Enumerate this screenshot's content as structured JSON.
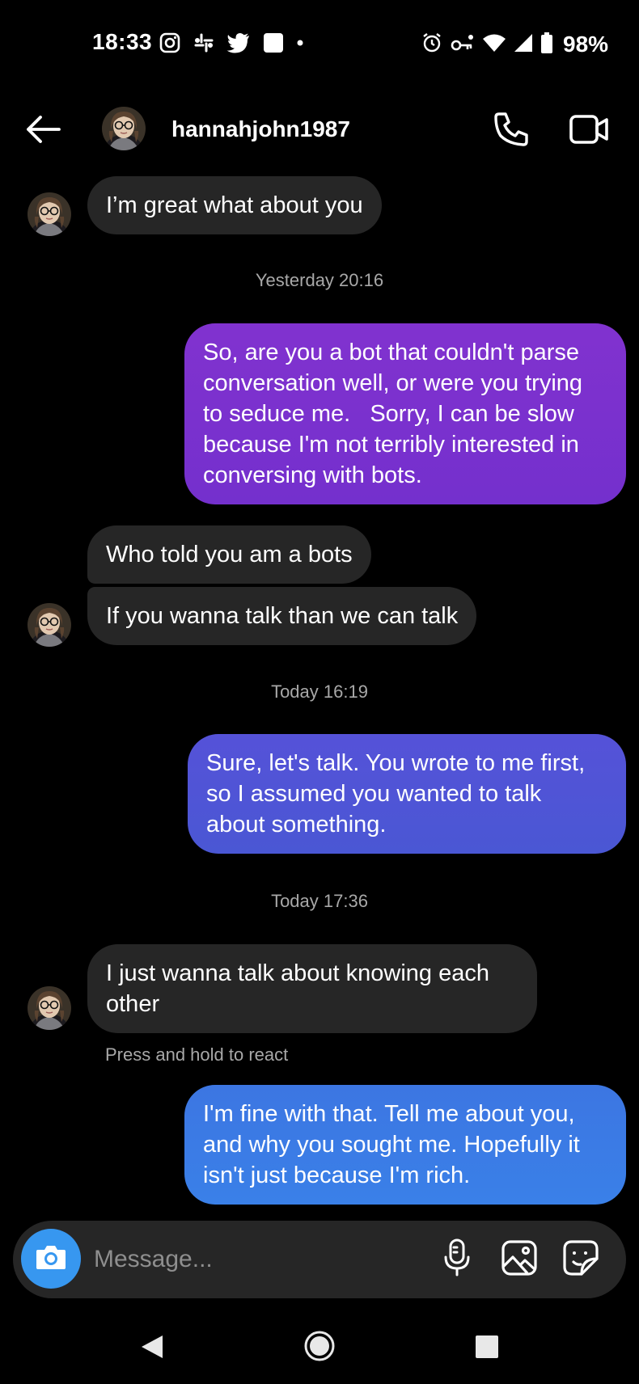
{
  "status_bar": {
    "time": "18:33",
    "battery": "98%",
    "left_icons": [
      "instagram-icon",
      "slack-icon",
      "twitter-icon",
      "square-notification-icon",
      "dot-icon"
    ],
    "right_icons": [
      "alarm-icon",
      "vpn-key-icon",
      "wifi-icon",
      "signal-icon",
      "battery-icon"
    ]
  },
  "header": {
    "username": "hannahjohn1987",
    "back_icon": "arrow-left-icon",
    "call_icon": "phone-icon",
    "video_icon": "video-camera-icon"
  },
  "messages": [
    {
      "from": "them",
      "text": "I’m great what about you"
    },
    {
      "type": "timestamp",
      "text": "Yesterday 20:16"
    },
    {
      "from": "me",
      "lines": [
        "So, are you a bot that couldn't parse",
        "conversation well, or were you trying",
        "to seduce me.   Sorry, I can be slow",
        "because I'm not terribly interested in",
        "conversing with bots."
      ]
    },
    {
      "from": "them",
      "text": "Who told you am a bots"
    },
    {
      "from": "them",
      "text": "If you wanna talk than we can talk"
    },
    {
      "type": "timestamp",
      "text": "Today 16:19"
    },
    {
      "from": "me",
      "lines": [
        "Sure, let's talk. You wrote to me first,",
        "so I assumed you wanted to talk",
        "about something."
      ]
    },
    {
      "type": "timestamp",
      "text": "Today 17:36"
    },
    {
      "from": "them",
      "lines": [
        "I just wanna talk about knowing each",
        "other"
      ]
    },
    {
      "from": "me",
      "lines": [
        "I'm fine with that. Tell me about you,",
        "and why you sought me. Hopefully it",
        "isn't just because I'm rich."
      ]
    }
  ],
  "hint": "Press and hold to react",
  "composer": {
    "placeholder": "Message...",
    "icons": [
      "camera-icon",
      "microphone-icon",
      "gallery-icon",
      "sticker-icon"
    ]
  },
  "colors": {
    "incoming_bubble": "#262626",
    "outgoing_purple": "#7b2fce",
    "outgoing_indigo": "#4a55d6",
    "outgoing_blue": "#3a7de6",
    "camera_button": "#3797f0",
    "timestamp": "#a8a8a8"
  }
}
